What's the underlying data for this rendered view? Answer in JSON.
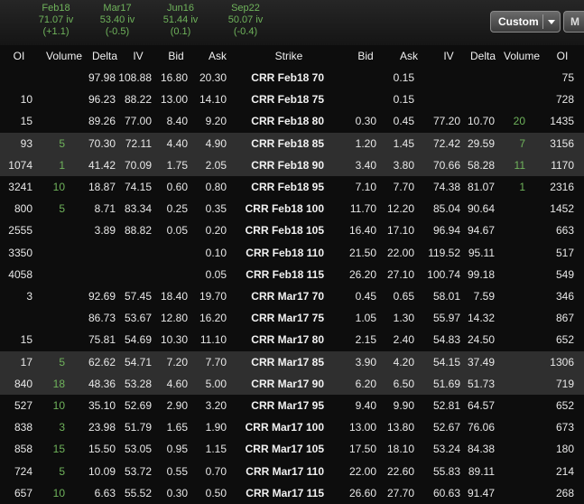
{
  "expiries": [
    {
      "month": "Feb18",
      "iv": "71.07 iv",
      "change": "(+1.1)"
    },
    {
      "month": "Mar17",
      "iv": "53.40 iv",
      "change": "(-0.5)"
    },
    {
      "month": "Jun16",
      "iv": "51.44 iv",
      "change": "(0.1)"
    },
    {
      "month": "Sep22",
      "iv": "50.07 iv",
      "change": "(-0.4)"
    }
  ],
  "toolbar": {
    "custom_label": "Custom",
    "extra_label": "M"
  },
  "columns": {
    "call": [
      "OI",
      "Volume",
      "Delta",
      "IV",
      "Bid",
      "Ask"
    ],
    "strike": "Strike",
    "put": [
      "Bid",
      "Ask",
      "IV",
      "Delta",
      "Volume",
      "OI"
    ]
  },
  "groups": [
    {
      "rows": [
        {
          "hl": false,
          "c_oi": "",
          "c_vol": "",
          "c_delta": "97.98",
          "c_iv": "108.88",
          "c_bid": "16.80",
          "c_ask": "20.30",
          "strike": "CRR Feb18 70",
          "p_bid": "",
          "p_ask": "0.15",
          "p_iv": "",
          "p_delta": "",
          "p_vol": "",
          "p_oi": "75"
        },
        {
          "hl": false,
          "c_oi": "10",
          "c_vol": "",
          "c_delta": "96.23",
          "c_iv": "88.22",
          "c_bid": "13.00",
          "c_ask": "14.10",
          "strike": "CRR Feb18 75",
          "p_bid": "",
          "p_ask": "0.15",
          "p_iv": "",
          "p_delta": "",
          "p_vol": "",
          "p_oi": "728"
        },
        {
          "hl": false,
          "c_oi": "15",
          "c_vol": "",
          "c_delta": "89.26",
          "c_iv": "77.00",
          "c_bid": "8.40",
          "c_ask": "9.20",
          "strike": "CRR Feb18 80",
          "p_bid": "0.30",
          "p_ask": "0.45",
          "p_iv": "77.20",
          "p_delta": "10.70",
          "p_vol": "20",
          "p_oi": "1435"
        },
        {
          "hl": true,
          "c_oi": "93",
          "c_vol": "5",
          "c_delta": "70.30",
          "c_iv": "72.11",
          "c_bid": "4.40",
          "c_ask": "4.90",
          "strike": "CRR Feb18 85",
          "p_bid": "1.20",
          "p_ask": "1.45",
          "p_iv": "72.42",
          "p_delta": "29.59",
          "p_vol": "7",
          "p_oi": "3156"
        },
        {
          "hl": true,
          "c_oi": "1074",
          "c_vol": "1",
          "c_delta": "41.42",
          "c_iv": "70.09",
          "c_bid": "1.75",
          "c_ask": "2.05",
          "strike": "CRR Feb18 90",
          "p_bid": "3.40",
          "p_ask": "3.80",
          "p_iv": "70.66",
          "p_delta": "58.28",
          "p_vol": "11",
          "p_oi": "1170"
        },
        {
          "hl": false,
          "c_oi": "3241",
          "c_vol": "10",
          "c_delta": "18.87",
          "c_iv": "74.15",
          "c_bid": "0.60",
          "c_ask": "0.80",
          "strike": "CRR Feb18 95",
          "p_bid": "7.10",
          "p_ask": "7.70",
          "p_iv": "74.38",
          "p_delta": "81.07",
          "p_vol": "1",
          "p_oi": "2316"
        },
        {
          "hl": false,
          "c_oi": "800",
          "c_vol": "5",
          "c_delta": "8.71",
          "c_iv": "83.34",
          "c_bid": "0.25",
          "c_ask": "0.35",
          "strike": "CRR Feb18 100",
          "p_bid": "11.70",
          "p_ask": "12.20",
          "p_iv": "85.04",
          "p_delta": "90.64",
          "p_vol": "",
          "p_oi": "1452"
        },
        {
          "hl": false,
          "c_oi": "2555",
          "c_vol": "",
          "c_delta": "3.89",
          "c_iv": "88.82",
          "c_bid": "0.05",
          "c_ask": "0.20",
          "strike": "CRR Feb18 105",
          "p_bid": "16.40",
          "p_ask": "17.10",
          "p_iv": "96.94",
          "p_delta": "94.67",
          "p_vol": "",
          "p_oi": "663"
        },
        {
          "hl": false,
          "c_oi": "3350",
          "c_vol": "",
          "c_delta": "",
          "c_iv": "",
          "c_bid": "",
          "c_ask": "0.10",
          "strike": "CRR Feb18 110",
          "p_bid": "21.50",
          "p_ask": "22.00",
          "p_iv": "119.52",
          "p_delta": "95.11",
          "p_vol": "",
          "p_oi": "517"
        },
        {
          "hl": false,
          "c_oi": "4058",
          "c_vol": "",
          "c_delta": "",
          "c_iv": "",
          "c_bid": "",
          "c_ask": "0.05",
          "strike": "CRR Feb18 115",
          "p_bid": "26.20",
          "p_ask": "27.10",
          "p_iv": "100.74",
          "p_delta": "99.18",
          "p_vol": "",
          "p_oi": "549"
        }
      ]
    },
    {
      "rows": [
        {
          "hl": false,
          "c_oi": "3",
          "c_vol": "",
          "c_delta": "92.69",
          "c_iv": "57.45",
          "c_bid": "18.40",
          "c_ask": "19.70",
          "strike": "CRR Mar17 70",
          "p_bid": "0.45",
          "p_ask": "0.65",
          "p_iv": "58.01",
          "p_delta": "7.59",
          "p_vol": "",
          "p_oi": "346"
        },
        {
          "hl": false,
          "c_oi": "",
          "c_vol": "",
          "c_delta": "86.73",
          "c_iv": "53.67",
          "c_bid": "12.80",
          "c_ask": "16.20",
          "strike": "CRR Mar17 75",
          "p_bid": "1.05",
          "p_ask": "1.30",
          "p_iv": "55.97",
          "p_delta": "14.32",
          "p_vol": "",
          "p_oi": "867"
        },
        {
          "hl": false,
          "c_oi": "15",
          "c_vol": "",
          "c_delta": "75.81",
          "c_iv": "54.69",
          "c_bid": "10.30",
          "c_ask": "11.10",
          "strike": "CRR Mar17 80",
          "p_bid": "2.15",
          "p_ask": "2.40",
          "p_iv": "54.83",
          "p_delta": "24.50",
          "p_vol": "",
          "p_oi": "652"
        },
        {
          "hl": true,
          "c_oi": "17",
          "c_vol": "5",
          "c_delta": "62.62",
          "c_iv": "54.71",
          "c_bid": "7.20",
          "c_ask": "7.70",
          "strike": "CRR Mar17 85",
          "p_bid": "3.90",
          "p_ask": "4.20",
          "p_iv": "54.15",
          "p_delta": "37.49",
          "p_vol": "",
          "p_oi": "1306"
        },
        {
          "hl": true,
          "c_oi": "840",
          "c_vol": "18",
          "c_delta": "48.36",
          "c_iv": "53.28",
          "c_bid": "4.60",
          "c_ask": "5.00",
          "strike": "CRR Mar17 90",
          "p_bid": "6.20",
          "p_ask": "6.50",
          "p_iv": "51.69",
          "p_delta": "51.73",
          "p_vol": "",
          "p_oi": "719"
        },
        {
          "hl": false,
          "c_oi": "527",
          "c_vol": "10",
          "c_delta": "35.10",
          "c_iv": "52.69",
          "c_bid": "2.90",
          "c_ask": "3.20",
          "strike": "CRR Mar17 95",
          "p_bid": "9.40",
          "p_ask": "9.90",
          "p_iv": "52.81",
          "p_delta": "64.57",
          "p_vol": "",
          "p_oi": "652"
        },
        {
          "hl": false,
          "c_oi": "838",
          "c_vol": "3",
          "c_delta": "23.98",
          "c_iv": "51.79",
          "c_bid": "1.65",
          "c_ask": "1.90",
          "strike": "CRR Mar17 100",
          "p_bid": "13.00",
          "p_ask": "13.80",
          "p_iv": "52.67",
          "p_delta": "76.06",
          "p_vol": "",
          "p_oi": "673"
        },
        {
          "hl": false,
          "c_oi": "858",
          "c_vol": "15",
          "c_delta": "15.50",
          "c_iv": "53.05",
          "c_bid": "0.95",
          "c_ask": "1.15",
          "strike": "CRR Mar17 105",
          "p_bid": "17.50",
          "p_ask": "18.10",
          "p_iv": "53.24",
          "p_delta": "84.38",
          "p_vol": "",
          "p_oi": "180"
        },
        {
          "hl": false,
          "c_oi": "724",
          "c_vol": "5",
          "c_delta": "10.09",
          "c_iv": "53.72",
          "c_bid": "0.55",
          "c_ask": "0.70",
          "strike": "CRR Mar17 110",
          "p_bid": "22.00",
          "p_ask": "22.60",
          "p_iv": "55.83",
          "p_delta": "89.11",
          "p_vol": "",
          "p_oi": "214"
        },
        {
          "hl": false,
          "c_oi": "657",
          "c_vol": "10",
          "c_delta": "6.63",
          "c_iv": "55.52",
          "c_bid": "0.30",
          "c_ask": "0.50",
          "strike": "CRR Mar17 115",
          "p_bid": "26.60",
          "p_ask": "27.70",
          "p_iv": "60.63",
          "p_delta": "91.47",
          "p_vol": "",
          "p_oi": "268"
        }
      ]
    }
  ],
  "colors": {
    "background": "#0d0d0d",
    "highlight_row": "#2f2f2f",
    "volume_green": "#6fb35b",
    "text": "#e8e8e8"
  }
}
